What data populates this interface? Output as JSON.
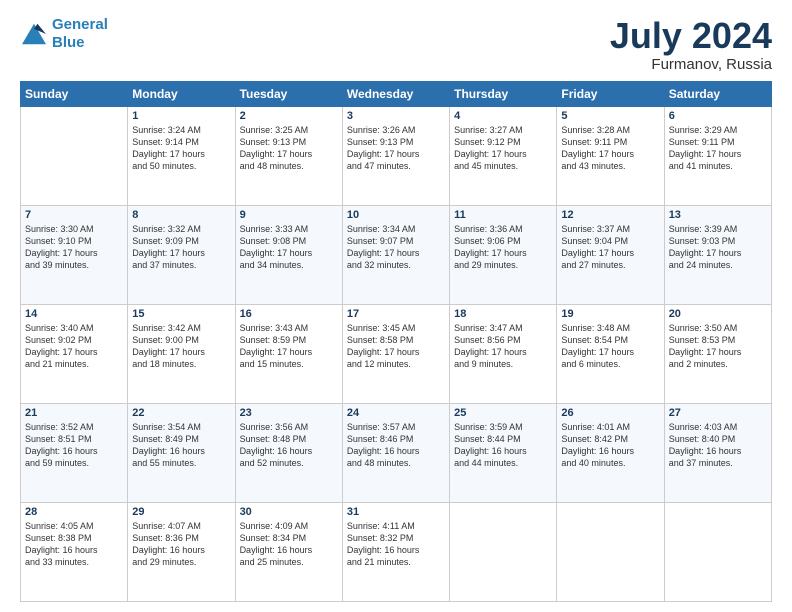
{
  "logo": {
    "line1": "General",
    "line2": "Blue"
  },
  "title": "July 2024",
  "subtitle": "Furmanov, Russia",
  "days_of_week": [
    "Sunday",
    "Monday",
    "Tuesday",
    "Wednesday",
    "Thursday",
    "Friday",
    "Saturday"
  ],
  "weeks": [
    [
      {
        "day": "",
        "content": ""
      },
      {
        "day": "1",
        "content": "Sunrise: 3:24 AM\nSunset: 9:14 PM\nDaylight: 17 hours\nand 50 minutes."
      },
      {
        "day": "2",
        "content": "Sunrise: 3:25 AM\nSunset: 9:13 PM\nDaylight: 17 hours\nand 48 minutes."
      },
      {
        "day": "3",
        "content": "Sunrise: 3:26 AM\nSunset: 9:13 PM\nDaylight: 17 hours\nand 47 minutes."
      },
      {
        "day": "4",
        "content": "Sunrise: 3:27 AM\nSunset: 9:12 PM\nDaylight: 17 hours\nand 45 minutes."
      },
      {
        "day": "5",
        "content": "Sunrise: 3:28 AM\nSunset: 9:11 PM\nDaylight: 17 hours\nand 43 minutes."
      },
      {
        "day": "6",
        "content": "Sunrise: 3:29 AM\nSunset: 9:11 PM\nDaylight: 17 hours\nand 41 minutes."
      }
    ],
    [
      {
        "day": "7",
        "content": "Sunrise: 3:30 AM\nSunset: 9:10 PM\nDaylight: 17 hours\nand 39 minutes."
      },
      {
        "day": "8",
        "content": "Sunrise: 3:32 AM\nSunset: 9:09 PM\nDaylight: 17 hours\nand 37 minutes."
      },
      {
        "day": "9",
        "content": "Sunrise: 3:33 AM\nSunset: 9:08 PM\nDaylight: 17 hours\nand 34 minutes."
      },
      {
        "day": "10",
        "content": "Sunrise: 3:34 AM\nSunset: 9:07 PM\nDaylight: 17 hours\nand 32 minutes."
      },
      {
        "day": "11",
        "content": "Sunrise: 3:36 AM\nSunset: 9:06 PM\nDaylight: 17 hours\nand 29 minutes."
      },
      {
        "day": "12",
        "content": "Sunrise: 3:37 AM\nSunset: 9:04 PM\nDaylight: 17 hours\nand 27 minutes."
      },
      {
        "day": "13",
        "content": "Sunrise: 3:39 AM\nSunset: 9:03 PM\nDaylight: 17 hours\nand 24 minutes."
      }
    ],
    [
      {
        "day": "14",
        "content": "Sunrise: 3:40 AM\nSunset: 9:02 PM\nDaylight: 17 hours\nand 21 minutes."
      },
      {
        "day": "15",
        "content": "Sunrise: 3:42 AM\nSunset: 9:00 PM\nDaylight: 17 hours\nand 18 minutes."
      },
      {
        "day": "16",
        "content": "Sunrise: 3:43 AM\nSunset: 8:59 PM\nDaylight: 17 hours\nand 15 minutes."
      },
      {
        "day": "17",
        "content": "Sunrise: 3:45 AM\nSunset: 8:58 PM\nDaylight: 17 hours\nand 12 minutes."
      },
      {
        "day": "18",
        "content": "Sunrise: 3:47 AM\nSunset: 8:56 PM\nDaylight: 17 hours\nand 9 minutes."
      },
      {
        "day": "19",
        "content": "Sunrise: 3:48 AM\nSunset: 8:54 PM\nDaylight: 17 hours\nand 6 minutes."
      },
      {
        "day": "20",
        "content": "Sunrise: 3:50 AM\nSunset: 8:53 PM\nDaylight: 17 hours\nand 2 minutes."
      }
    ],
    [
      {
        "day": "21",
        "content": "Sunrise: 3:52 AM\nSunset: 8:51 PM\nDaylight: 16 hours\nand 59 minutes."
      },
      {
        "day": "22",
        "content": "Sunrise: 3:54 AM\nSunset: 8:49 PM\nDaylight: 16 hours\nand 55 minutes."
      },
      {
        "day": "23",
        "content": "Sunrise: 3:56 AM\nSunset: 8:48 PM\nDaylight: 16 hours\nand 52 minutes."
      },
      {
        "day": "24",
        "content": "Sunrise: 3:57 AM\nSunset: 8:46 PM\nDaylight: 16 hours\nand 48 minutes."
      },
      {
        "day": "25",
        "content": "Sunrise: 3:59 AM\nSunset: 8:44 PM\nDaylight: 16 hours\nand 44 minutes."
      },
      {
        "day": "26",
        "content": "Sunrise: 4:01 AM\nSunset: 8:42 PM\nDaylight: 16 hours\nand 40 minutes."
      },
      {
        "day": "27",
        "content": "Sunrise: 4:03 AM\nSunset: 8:40 PM\nDaylight: 16 hours\nand 37 minutes."
      }
    ],
    [
      {
        "day": "28",
        "content": "Sunrise: 4:05 AM\nSunset: 8:38 PM\nDaylight: 16 hours\nand 33 minutes."
      },
      {
        "day": "29",
        "content": "Sunrise: 4:07 AM\nSunset: 8:36 PM\nDaylight: 16 hours\nand 29 minutes."
      },
      {
        "day": "30",
        "content": "Sunrise: 4:09 AM\nSunset: 8:34 PM\nDaylight: 16 hours\nand 25 minutes."
      },
      {
        "day": "31",
        "content": "Sunrise: 4:11 AM\nSunset: 8:32 PM\nDaylight: 16 hours\nand 21 minutes."
      },
      {
        "day": "",
        "content": ""
      },
      {
        "day": "",
        "content": ""
      },
      {
        "day": "",
        "content": ""
      }
    ]
  ]
}
